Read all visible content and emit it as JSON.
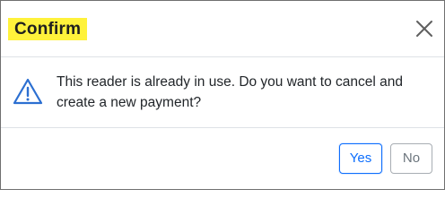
{
  "dialog": {
    "title": "Confirm",
    "title_highlight_color": "#fff23b",
    "close_icon": "close-icon",
    "warning_icon": "warning-triangle-icon",
    "message_line1": "This reader is already in use. Do you want to cancel and",
    "message_line2": "create a new payment?",
    "buttons": {
      "yes_label": "Yes",
      "no_label": "No"
    },
    "colors": {
      "primary": "#0d6efd",
      "secondary": "#6c757d",
      "icon_blue": "#2c6fd1"
    }
  }
}
